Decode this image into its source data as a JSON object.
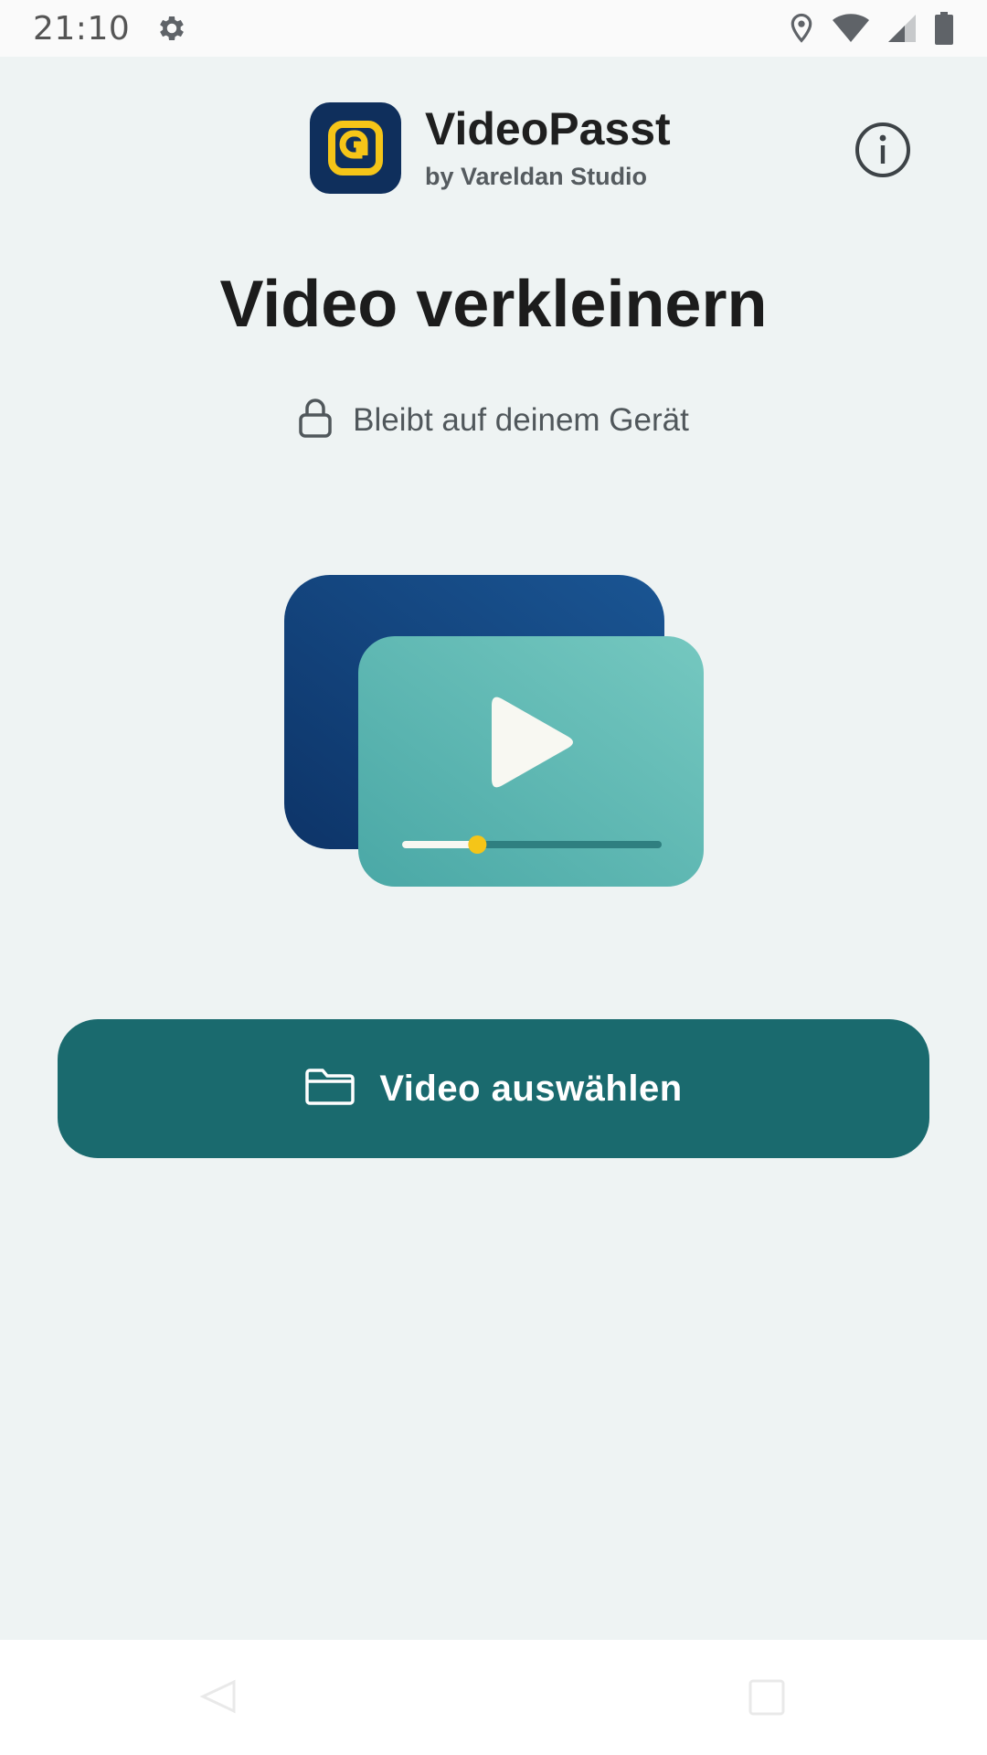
{
  "status_bar": {
    "time": "21:10",
    "icons": [
      "settings-gear-icon",
      "location-icon",
      "wifi-icon",
      "cell-signal-icon",
      "battery-icon"
    ]
  },
  "header": {
    "app_name": "VideoPasst",
    "vendor": "by Vareldan Studio",
    "logo_icon": "app-logo-icon",
    "info_icon": "info-icon"
  },
  "main": {
    "title": "Video verkleinern",
    "privacy_note": "Bleibt auf deinem Gerät",
    "privacy_icon": "lock-icon",
    "illustration": {
      "icon": "video-player-illustration",
      "playback_progress": 0.29
    },
    "select_button": {
      "label": "Video auswählen",
      "icon": "folder-icon"
    }
  },
  "nav_bar": {
    "icons": [
      "back-icon",
      "recents-icon"
    ]
  },
  "colors": {
    "background": "#eef3f3",
    "accent": "#1a6a6e",
    "logo_bg": "#0f2f5c",
    "logo_fg": "#f5c518",
    "illustration_back": "#14457e",
    "illustration_front": "#5bb5b0",
    "progress_knob": "#f5c518"
  }
}
